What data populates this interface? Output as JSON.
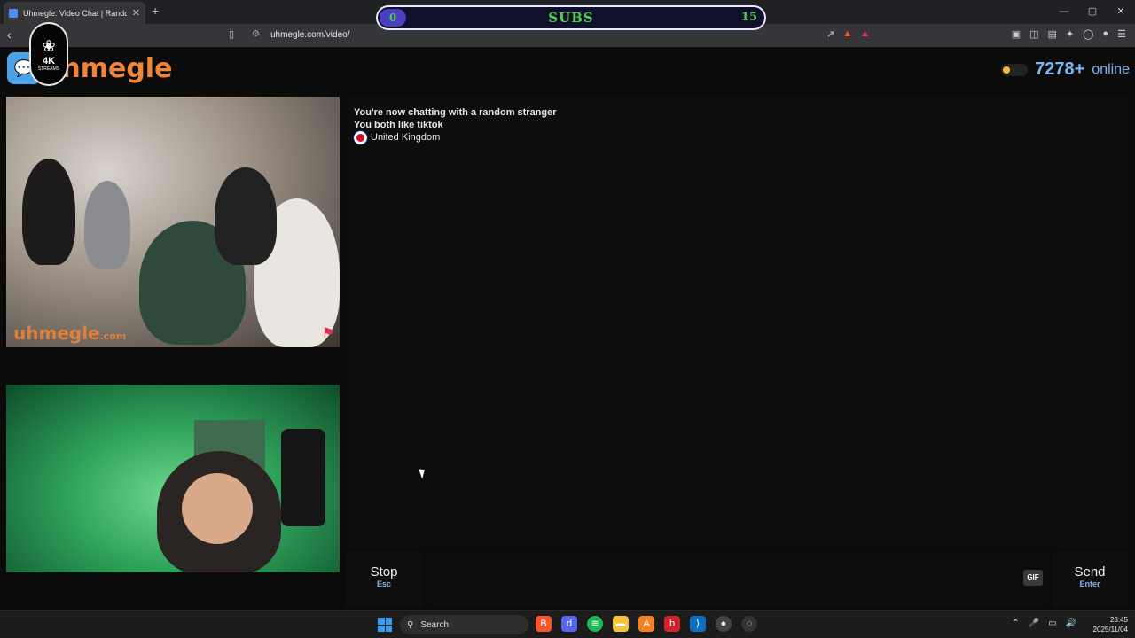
{
  "browser": {
    "tab_title": "Uhmegle: Video Chat | Random",
    "tab_close": "✕",
    "new_tab": "+",
    "url": "uhmegle.com/video/",
    "window_controls": [
      "—",
      "▢",
      "✕"
    ]
  },
  "overlay": {
    "subs_current": "0",
    "subs_label": "SUBS",
    "subs_goal": "15",
    "badge_big": "4K",
    "badge_small": "STREAMS"
  },
  "site": {
    "logo_text": "uhmegle",
    "online_count": "7278+",
    "online_word": "online",
    "watermark_main": "uhmegle",
    "watermark_suffix": ".com"
  },
  "chat": {
    "line1": "You're now chatting with a random stranger",
    "line2": "You both like tiktok",
    "country": "United Kingdom"
  },
  "controls": {
    "stop_label": "Stop",
    "stop_hint": "Esc",
    "gif_label": "GIF",
    "send_label": "Send",
    "send_hint": "Enter"
  },
  "taskbar": {
    "search_label": "Search",
    "time": "23:45",
    "date": "2025/11/04"
  }
}
